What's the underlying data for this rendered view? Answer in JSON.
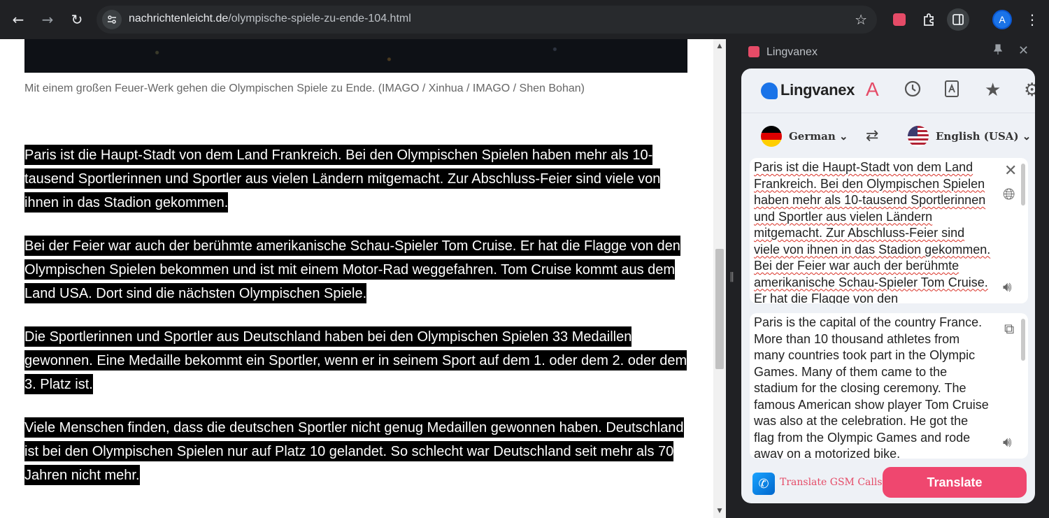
{
  "browser": {
    "url_host": "nachrichtenleicht.de",
    "url_path": "/olympische-spiele-zu-ende-104.html",
    "back_icon": "←",
    "forward_icon": "→",
    "reload_icon": "↻",
    "star_icon": "☆",
    "profile_initial": "A",
    "menu_icon": "⋮"
  },
  "article": {
    "caption": "Mit einem großen Feuer-Werk gehen die Olympischen Spiele zu Ende. (IMAGO / Xinhua / IMAGO / Shen Bohan)",
    "paragraphs": [
      "Paris ist die Haupt-Stadt von dem Land Frankreich. Bei den Olympischen Spielen haben mehr als 10-tausend Sportlerinnen und Sportler aus vielen Ländern mitgemacht. Zur Abschluss-Feier sind viele von ihnen in das Stadion gekommen.",
      "Bei der Feier war auch der berühmte amerikanische Schau-Spieler Tom Cruise. Er hat die Flagge von den Olympischen Spielen bekommen und ist mit einem Motor-Rad weggefahren. Tom Cruise kommt aus dem Land USA. Dort sind die nächsten Olympischen Spiele.",
      "Die Sportlerinnen und Sportler aus Deutschland haben bei den Olympischen Spielen 33 Medaillen gewonnen. Eine Medaille bekommt ein Sportler, wenn er in seinem Sport auf dem 1. oder dem 2. oder dem 3. Platz ist.",
      "Viele Menschen finden, dass die deutschen Sportler nicht genug Medaillen gewonnen haben. Deutschland ist bei den Olympischen Spielen nur auf Platz 10 gelandet. So schlecht war Deutschland seit mehr als 70 Jahren nicht mehr."
    ]
  },
  "side_panel": {
    "title": "Lingvanex",
    "brand": "Lingvanex",
    "brand_letter": "A",
    "source_lang": "German",
    "target_lang": "English (USA)",
    "source_text": "Paris ist die Haupt-Stadt von dem Land Frankreich. Bei den Olympischen Spielen haben mehr als 10-tausend Sportlerinnen und Sportler aus vielen Ländern mitgemacht. Zur Abschluss-Feier sind viele von ihnen in das Stadion gekommen. Bei der Feier war auch der berühmte amerikanische Schau-Spieler Tom Cruise. Er hat die Flagge von den",
    "target_text": "Paris is the capital of the country France. More than 10 thousand athletes from many countries took part in the Olympic Games. Many of them came to the stadium for the closing ceremony. The famous American show player Tom Cruise was also at the celebration. He got the flag from the Olympic Games and rode away on a motorized bike.",
    "gsm_link": "Translate GSM Calls",
    "translate_button": "Translate"
  },
  "colors": {
    "accent": "#ef476f",
    "brand_red": "#e54b67",
    "highlight_bg": "#000000"
  }
}
